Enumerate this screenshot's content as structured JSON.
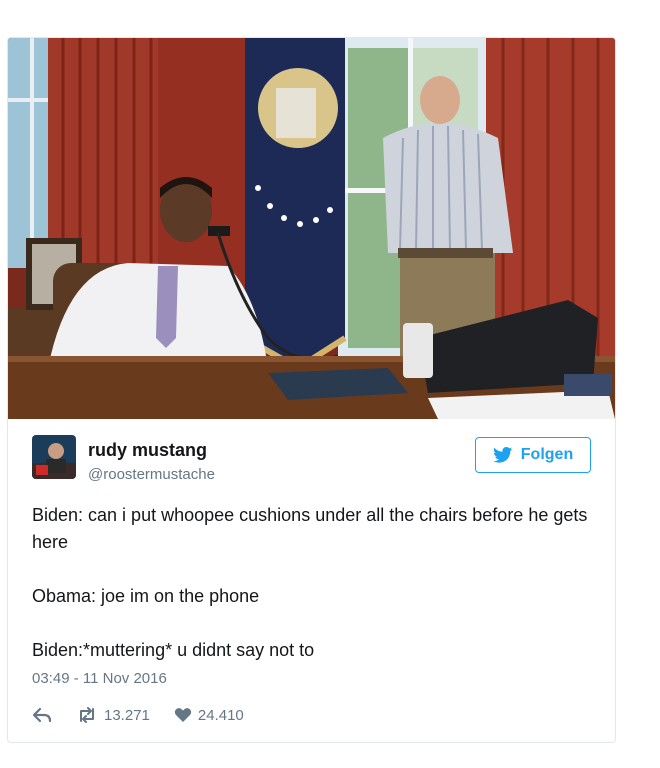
{
  "tweet": {
    "user_name": "rudy mustang",
    "user_handle": "@roostermustache",
    "follow_label": "Folgen",
    "lines": [
      "Biden: can i put whoopee cushions under all the chairs before he gets here",
      "Obama: joe im on the phone",
      "Biden:*muttering* u didnt say not to"
    ],
    "timestamp": "03:49 - 11 Nov 2016",
    "retweets": "13.271",
    "likes": "24.410"
  },
  "colors": {
    "accent": "#1da1f2",
    "secondary_text": "#657786",
    "border": "#e1e8ed"
  },
  "icons": [
    "reply-icon",
    "retweet-icon",
    "heart-icon",
    "twitter-bird-icon"
  ]
}
